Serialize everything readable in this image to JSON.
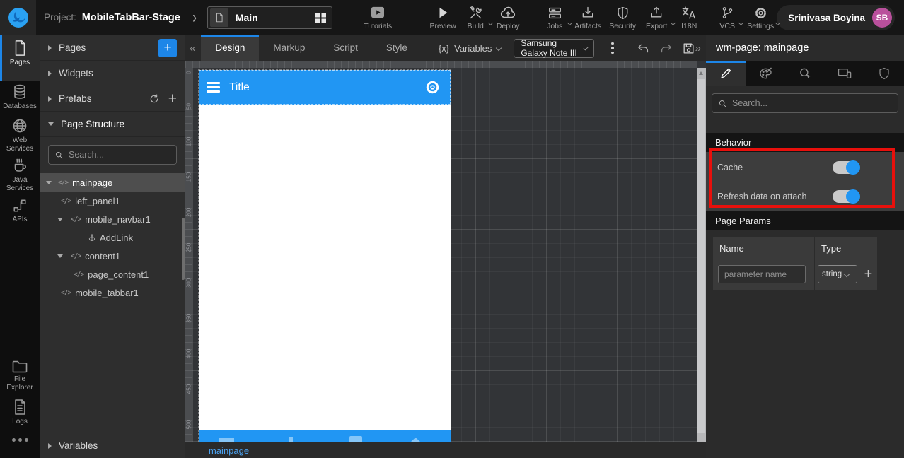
{
  "topbar": {
    "project_label": "Project:",
    "project_name": "MobileTabBar-Stage",
    "main_selector": "Main",
    "actions": {
      "tutorials": "Tutorials",
      "preview": "Preview",
      "build": "Build",
      "deploy": "Deploy",
      "jobs": "Jobs",
      "artifacts": "Artifacts",
      "security": "Security",
      "export": "Export",
      "i18n": "I18N",
      "vcs": "VCS",
      "settings": "Settings"
    },
    "user": {
      "name": "Srinivasa Boyina",
      "initials": "SB",
      "avatar_color": "#b9509c"
    }
  },
  "rail": {
    "pages": "Pages",
    "databases": "Databases",
    "web_services": "Web Services",
    "java_services": "Java Services",
    "apis": "APIs",
    "file_explorer": "File Explorer",
    "logs": "Logs"
  },
  "left_panel": {
    "sections": {
      "pages": "Pages",
      "widgets": "Widgets",
      "prefabs": "Prefabs",
      "page_structure": "Page Structure",
      "variables": "Variables"
    },
    "search_placeholder": "Search...",
    "tree": {
      "mainpage": "mainpage",
      "left_panel1": "left_panel1",
      "mobile_navbar1": "mobile_navbar1",
      "addlink": "AddLink",
      "content1": "content1",
      "page_content1": "page_content1",
      "mobile_tabbar1": "mobile_tabbar1"
    }
  },
  "editor": {
    "tabs": {
      "design": "Design",
      "markup": "Markup",
      "script": "Script",
      "style": "Style"
    },
    "variables_prefix": "{x}",
    "variables_label": "Variables",
    "device_select": "Samsung Galaxy Note III",
    "bottom_tab": "mainpage"
  },
  "canvas": {
    "ruler": [
      "0",
      "50",
      "100",
      "150",
      "200",
      "250",
      "300",
      "350",
      "400",
      "450",
      "500"
    ],
    "phone": {
      "title": "Title"
    }
  },
  "inspector": {
    "header": "wm-page: mainpage",
    "search_placeholder": "Search...",
    "behavior": {
      "title": "Behavior",
      "cache_label": "Cache",
      "cache_on": true,
      "refresh_label": "Refresh data on attach",
      "refresh_on": true
    },
    "page_params": {
      "title": "Page Params",
      "name_header": "Name",
      "type_header": "Type",
      "param_placeholder": "parameter name",
      "type_value": "string"
    }
  },
  "colors": {
    "accent": "#1d86e8",
    "phone_blue": "#2196f3",
    "highlight_red": "#e8100c"
  }
}
